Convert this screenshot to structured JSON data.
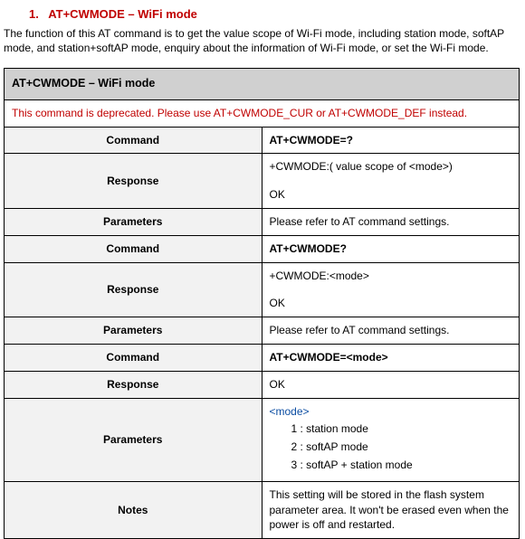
{
  "section": {
    "number": "1.",
    "title": "AT+CWMODE – WiFi mode",
    "description": "The function of this AT command is to get the value scope of Wi-Fi mode, including station mode, softAP mode, and station+softAP mode, enquiry about the information of Wi-Fi mode, or set the Wi-Fi mode."
  },
  "table": {
    "header": "AT+CWMODE – WiFi mode",
    "deprecated": "This command is deprecated. Please use AT+CWMODE_CUR or AT+CWMODE_DEF instead.",
    "labels": {
      "command": "Command",
      "response": "Response",
      "parameters": "Parameters",
      "notes": "Notes"
    },
    "rows": [
      {
        "command": "AT+CWMODE=?",
        "response_line1": "+CWMODE:( value scope of <mode>)",
        "response_line2": "OK",
        "parameters_text": "Please refer to AT command settings."
      },
      {
        "command": "AT+CWMODE?",
        "response_line1": "+CWMODE:<mode>",
        "response_line2": "OK",
        "parameters_text": "Please refer to AT command settings."
      },
      {
        "command": "AT+CWMODE=<mode>",
        "response_line1": "OK",
        "parameters_mode_tag": "<mode>",
        "parameters_modes": {
          "m1": "1 :  station mode",
          "m2": "2 :  softAP mode",
          "m3": "3 :  softAP + station mode"
        }
      }
    ],
    "notes": "This setting will be stored in the flash system parameter area. It won't be erased even when the power is off and restarted."
  }
}
